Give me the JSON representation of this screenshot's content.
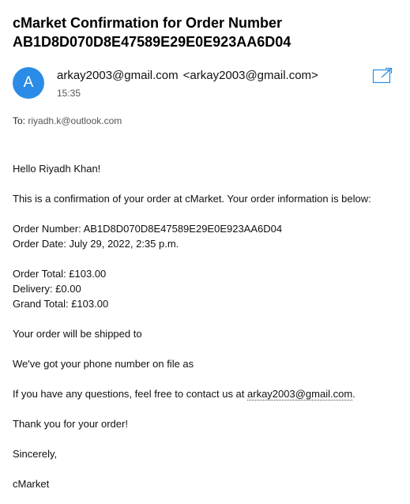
{
  "email": {
    "subject": "cMarket Confirmation for Order Number AB1D8D070D8E47589E29E0E923AA6D04",
    "avatar_letter": "A",
    "sender_name": "arkay2003@gmail.com",
    "sender_email": "<arkay2003@gmail.com>",
    "time": "15:35",
    "to_label": "To:",
    "to_address": "riyadh.k@outlook.com",
    "icons": {
      "popout": "open-in-new-window-icon"
    },
    "colors": {
      "avatar": "#2a8ce6",
      "popout_icon": "#2a8ce6"
    }
  },
  "body": {
    "greeting": "Hello Riyadh Khan!",
    "intro": "This is a confirmation of your order at cMarket. Your order information is below:",
    "order_number": "Order Number: AB1D8D070D8E47589E29E0E923AA6D04",
    "order_date": "Order Date: July 29, 2022, 2:35 p.m.",
    "order_total": "Order Total: £103.00",
    "delivery": "Delivery: £0.00",
    "grand_total": "Grand Total: £103.00",
    "shipping": "Your order will be shipped to",
    "phone": "We've got your phone number on file as",
    "questions_prefix": "If you have any questions, feel free to contact us at ",
    "contact_email": "arkay2003@gmail.com",
    "questions_suffix": ".",
    "thanks": "Thank you for your order!",
    "signoff": "Sincerely,",
    "signature": "cMarket"
  }
}
